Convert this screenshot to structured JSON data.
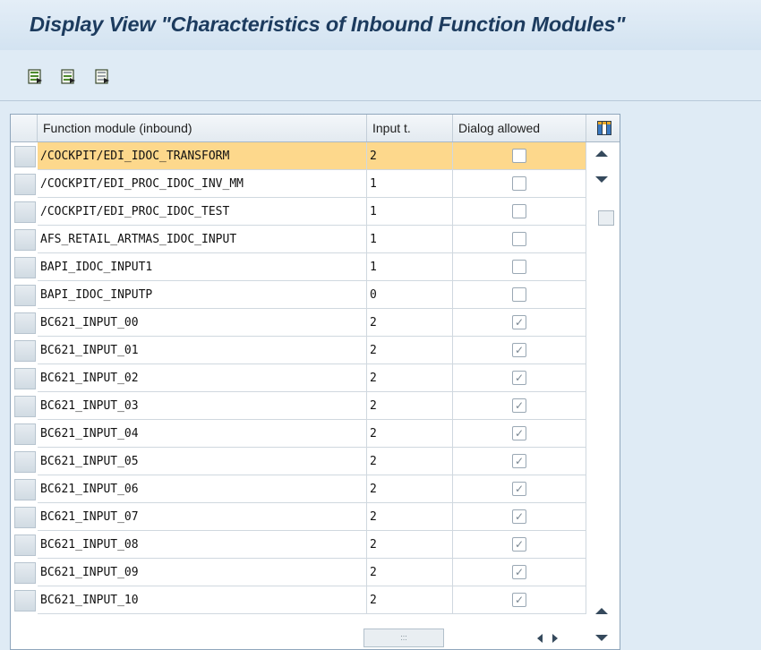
{
  "window": {
    "title": "Display View \"Characteristics of Inbound Function Modules\""
  },
  "toolbar": {
    "icons": [
      "select-all-icon",
      "select-block-icon",
      "deselect-all-icon"
    ]
  },
  "table": {
    "columns": {
      "function_module": "Function module (inbound)",
      "input_type": "Input t.",
      "dialog_allowed": "Dialog allowed"
    },
    "selected_row_index": 0,
    "rows": [
      {
        "module": "/COCKPIT/EDI_IDOC_TRANSFORM",
        "input": "2",
        "dialog": false
      },
      {
        "module": "/COCKPIT/EDI_PROC_IDOC_INV_MM",
        "input": "1",
        "dialog": false
      },
      {
        "module": "/COCKPIT/EDI_PROC_IDOC_TEST",
        "input": "1",
        "dialog": false
      },
      {
        "module": "AFS_RETAIL_ARTMAS_IDOC_INPUT",
        "input": "1",
        "dialog": false
      },
      {
        "module": "BAPI_IDOC_INPUT1",
        "input": "1",
        "dialog": false
      },
      {
        "module": "BAPI_IDOC_INPUTP",
        "input": "0",
        "dialog": false
      },
      {
        "module": "BC621_INPUT_00",
        "input": "2",
        "dialog": true
      },
      {
        "module": "BC621_INPUT_01",
        "input": "2",
        "dialog": true
      },
      {
        "module": "BC621_INPUT_02",
        "input": "2",
        "dialog": true
      },
      {
        "module": "BC621_INPUT_03",
        "input": "2",
        "dialog": true
      },
      {
        "module": "BC621_INPUT_04",
        "input": "2",
        "dialog": true
      },
      {
        "module": "BC621_INPUT_05",
        "input": "2",
        "dialog": true
      },
      {
        "module": "BC621_INPUT_06",
        "input": "2",
        "dialog": true
      },
      {
        "module": "BC621_INPUT_07",
        "input": "2",
        "dialog": true
      },
      {
        "module": "BC621_INPUT_08",
        "input": "2",
        "dialog": true
      },
      {
        "module": "BC621_INPUT_09",
        "input": "2",
        "dialog": true
      },
      {
        "module": "BC621_INPUT_10",
        "input": "2",
        "dialog": true
      }
    ]
  },
  "colors": {
    "selected_row": "#fdd88c",
    "title_text": "#1c3b5e",
    "background": "#dfebf5"
  }
}
